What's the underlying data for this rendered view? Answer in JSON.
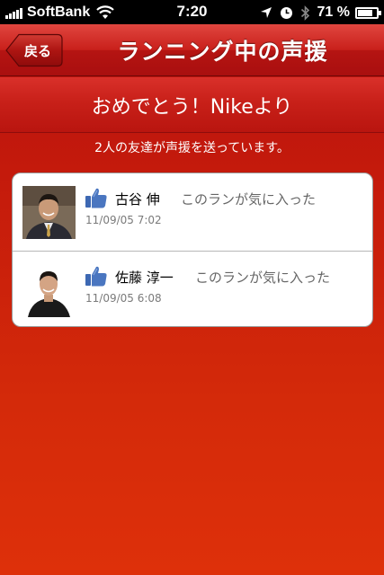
{
  "status_bar": {
    "carrier": "SoftBank",
    "time": "7:20",
    "battery_percent": "71 %",
    "battery_level": 0.71,
    "icons": [
      "signal-icon",
      "wifi-icon",
      "location-arrow-icon",
      "clock-icon",
      "bluetooth-icon",
      "battery-icon"
    ]
  },
  "nav": {
    "back_label": "戻る",
    "title": "ランニング中の声援"
  },
  "banner": {
    "text": "おめでとう！Nikeより"
  },
  "cheer_count_text": "2人の友達が声援を送っています。",
  "cheers": [
    {
      "name": "古谷 伸",
      "message": "このランが気に入った",
      "timestamp": "11/09/05 7:02",
      "icon": "thumbs-up-icon"
    },
    {
      "name": "佐藤 淳一",
      "message": "このランが気に入った",
      "timestamp": "11/09/05 6:08",
      "icon": "thumbs-up-icon"
    }
  ],
  "colors": {
    "nav_red": "#c9201b",
    "background_red": "#d42a0a",
    "like_blue": "#4a76c0"
  }
}
